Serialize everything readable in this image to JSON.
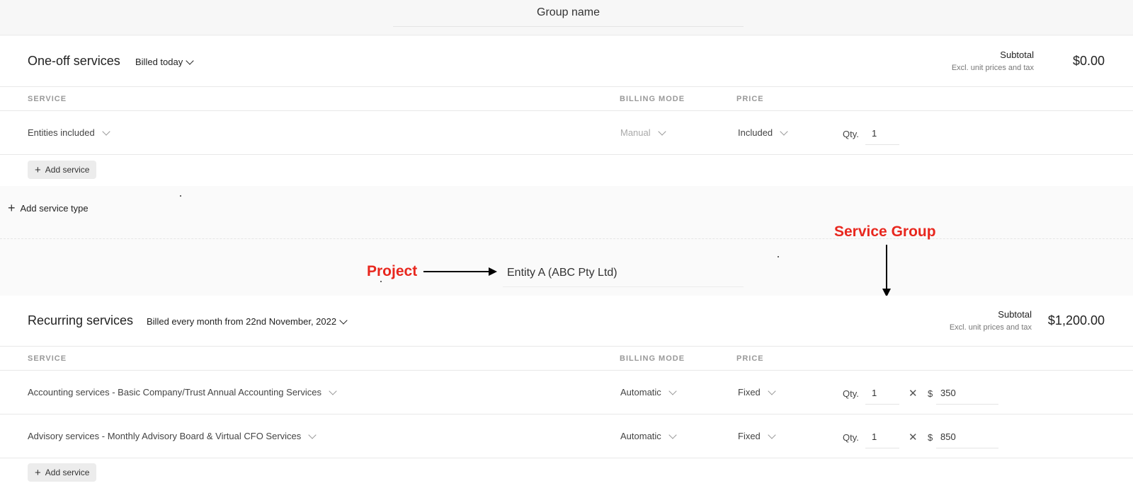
{
  "group": {
    "name_placeholder": "Group name"
  },
  "oneoff": {
    "title": "One-off services",
    "billing": "Billed today",
    "subtotal_label": "Subtotal",
    "subtotal_note": "Excl. unit prices and tax",
    "subtotal_amount": "$0.00",
    "columns": {
      "service": "SERVICE",
      "billing_mode": "BILLING MODE",
      "price": "PRICE"
    },
    "rows": [
      {
        "service": "Entities included",
        "billing_mode": "Manual",
        "price": "Included",
        "qty_label": "Qty.",
        "qty": "1"
      }
    ],
    "add_service_label": "Add service"
  },
  "add_service_type_label": "Add service type",
  "project": {
    "name": "Entity A (ABC Pty Ltd)"
  },
  "annotations": {
    "project": "Project",
    "service_group": "Service Group",
    "color": "#e8271e"
  },
  "recurring": {
    "title": "Recurring services",
    "billing": "Billed every month from 22nd November, 2022",
    "subtotal_label": "Subtotal",
    "subtotal_note": "Excl. unit prices and tax",
    "subtotal_amount": "$1,200.00",
    "columns": {
      "service": "SERVICE",
      "billing_mode": "BILLING MODE",
      "price": "PRICE"
    },
    "rows": [
      {
        "service": "Accounting services - Basic Company/Trust Annual Accounting Services",
        "billing_mode": "Automatic",
        "price": "Fixed",
        "qty_label": "Qty.",
        "qty": "1",
        "times": "✕",
        "currency": "$",
        "unit_price": "350"
      },
      {
        "service": "Advisory services - Monthly Advisory Board & Virtual CFO Services",
        "billing_mode": "Automatic",
        "price": "Fixed",
        "qty_label": "Qty.",
        "qty": "1",
        "times": "✕",
        "currency": "$",
        "unit_price": "850"
      }
    ],
    "add_service_label": "Add service"
  }
}
